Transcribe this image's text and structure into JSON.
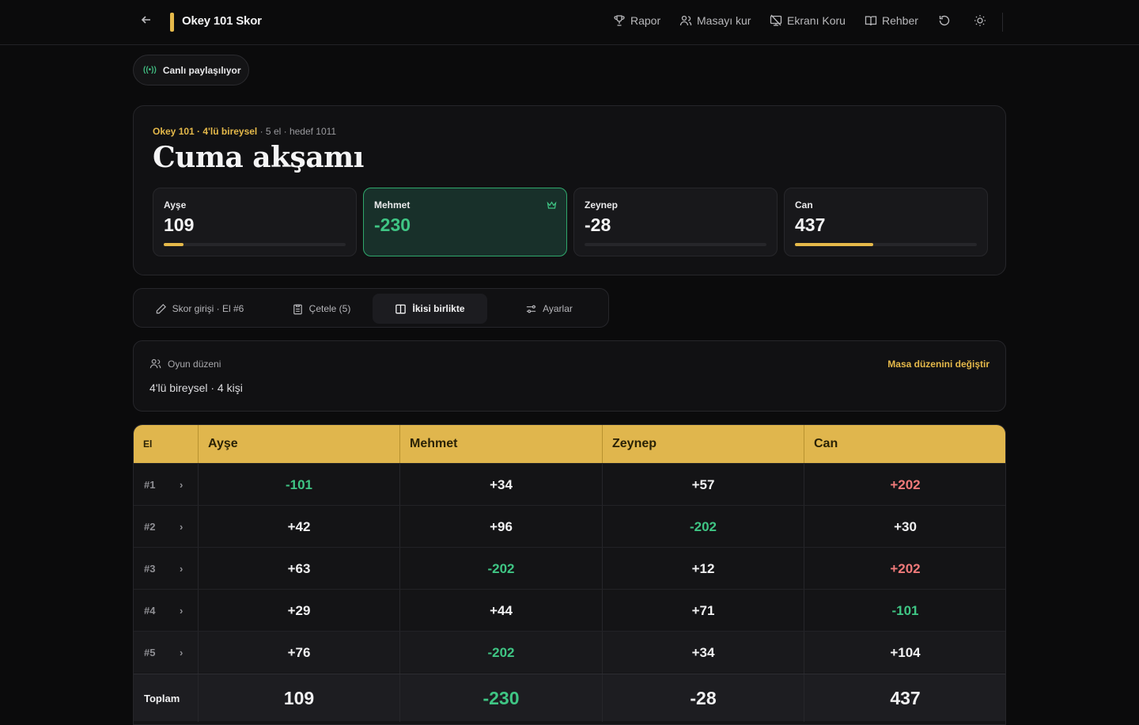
{
  "header": {
    "brand": "Okey 101 Skor",
    "nav": [
      {
        "label": "Rapor",
        "icon": "trophy-icon"
      },
      {
        "label": "Masayı kur",
        "icon": "users-icon"
      },
      {
        "label": "Ekranı Koru",
        "icon": "screen-off-icon"
      },
      {
        "label": "Rehber",
        "icon": "book-icon"
      }
    ]
  },
  "live_badge": "Canlı paylaşılıyor",
  "game": {
    "meta_variant": "Okey 101 · 4'lü bireysel",
    "meta_rest": " · 5 el · hedef 1011",
    "title": "Cuma akşamı",
    "players": [
      {
        "name": "Ayşe",
        "score": "109",
        "progress": 0.108
      },
      {
        "name": "Mehmet",
        "score": "-230",
        "progress": 0,
        "leader": true
      },
      {
        "name": "Zeynep",
        "score": "-28",
        "progress": 0
      },
      {
        "name": "Can",
        "score": "437",
        "progress": 0.432
      }
    ]
  },
  "tabs": [
    {
      "label": "Skor girişi  · El #6",
      "icon": "pencil-icon"
    },
    {
      "label": "Çetele (5)",
      "icon": "clipboard-icon"
    },
    {
      "label": "İkisi birlikte",
      "icon": "columns-icon",
      "active": true
    },
    {
      "label": "Ayarlar",
      "icon": "sliders-icon"
    }
  ],
  "layout_panel": {
    "label": "Oyun düzeni",
    "value": "4'lü bireysel · 4 kişi",
    "change": "Masa düzenini değiştir"
  },
  "table": {
    "headers": [
      "El",
      "Ayşe",
      "Mehmet",
      "Zeynep",
      "Can"
    ],
    "rows": [
      {
        "el": "#1",
        "values": [
          "-101",
          "+34",
          "+57",
          "+202"
        ]
      },
      {
        "el": "#2",
        "values": [
          "+42",
          "+96",
          "-202",
          "+30"
        ]
      },
      {
        "el": "#3",
        "values": [
          "+63",
          "-202",
          "+12",
          "+202"
        ]
      },
      {
        "el": "#4",
        "values": [
          "+29",
          "+44",
          "+71",
          "-101"
        ]
      },
      {
        "el": "#5",
        "values": [
          "+76",
          "-202",
          "+34",
          "+104"
        ]
      }
    ],
    "total_label": "Toplam",
    "totals": [
      "109",
      "-230",
      "-28",
      "437"
    ]
  },
  "colors": {
    "accent": "#e5b94a",
    "positive": "#3fc584",
    "penalty": "#f07a7a"
  }
}
